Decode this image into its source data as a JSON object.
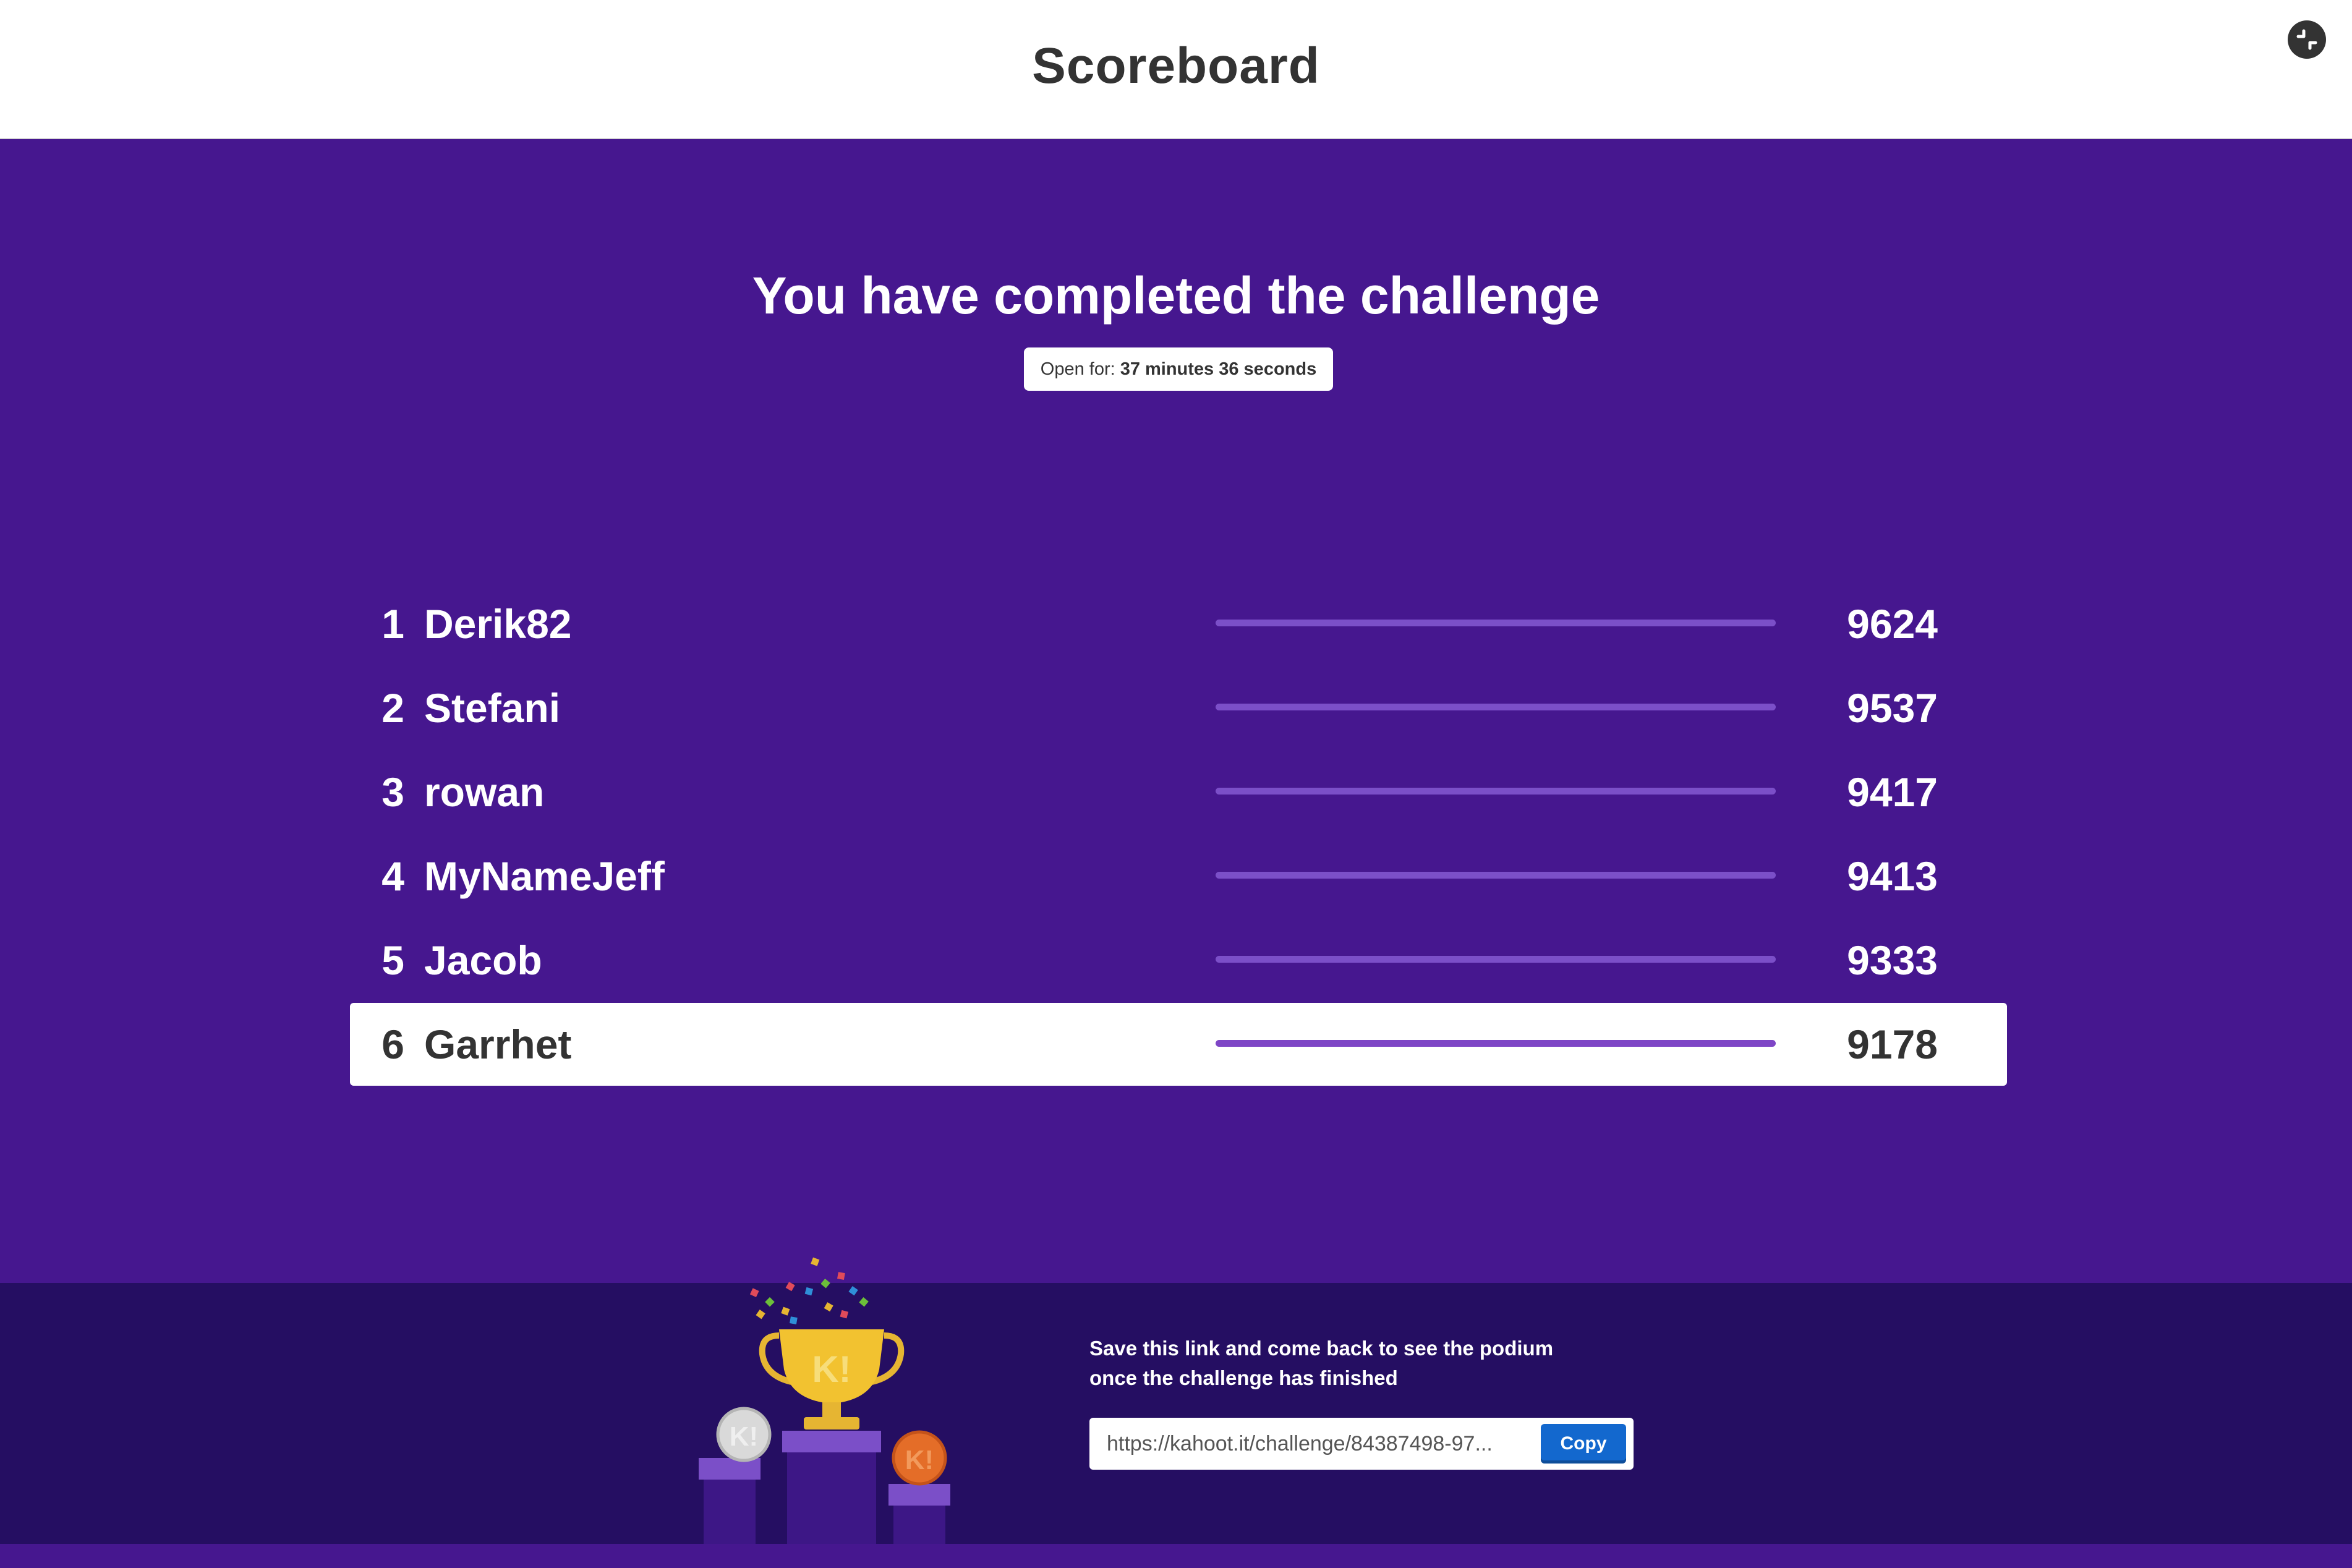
{
  "header": {
    "title": "Scoreboard",
    "fullscreen_icon": "fullscreen-exit-icon"
  },
  "challenge": {
    "headline": "You have completed the challenge",
    "open_for_label": "Open for:",
    "open_for_value": "37 minutes 36 seconds"
  },
  "scoreboard": {
    "rows": [
      {
        "rank": "1",
        "name": "Derik82",
        "score": "9624",
        "highlighted": false
      },
      {
        "rank": "2",
        "name": "Stefani",
        "score": "9537",
        "highlighted": false
      },
      {
        "rank": "3",
        "name": "rowan",
        "score": "9417",
        "highlighted": false
      },
      {
        "rank": "4",
        "name": "MyNameJeff",
        "score": "9413",
        "highlighted": false
      },
      {
        "rank": "5",
        "name": "Jacob",
        "score": "9333",
        "highlighted": false
      },
      {
        "rank": "6",
        "name": "Garrhet",
        "score": "9178",
        "highlighted": true
      }
    ]
  },
  "footer": {
    "save_text_line1": "Save this link and come back to see the podium",
    "save_text_line2": "once the challenge has finished",
    "link_value": "https://kahoot.it/challenge/84387498-97...",
    "copy_label": "Copy",
    "illustration_icon": "trophy-podium-icon"
  },
  "colors": {
    "brand_purple": "#46178f",
    "footer_purple": "#250e62",
    "copy_blue": "#1368ce"
  }
}
